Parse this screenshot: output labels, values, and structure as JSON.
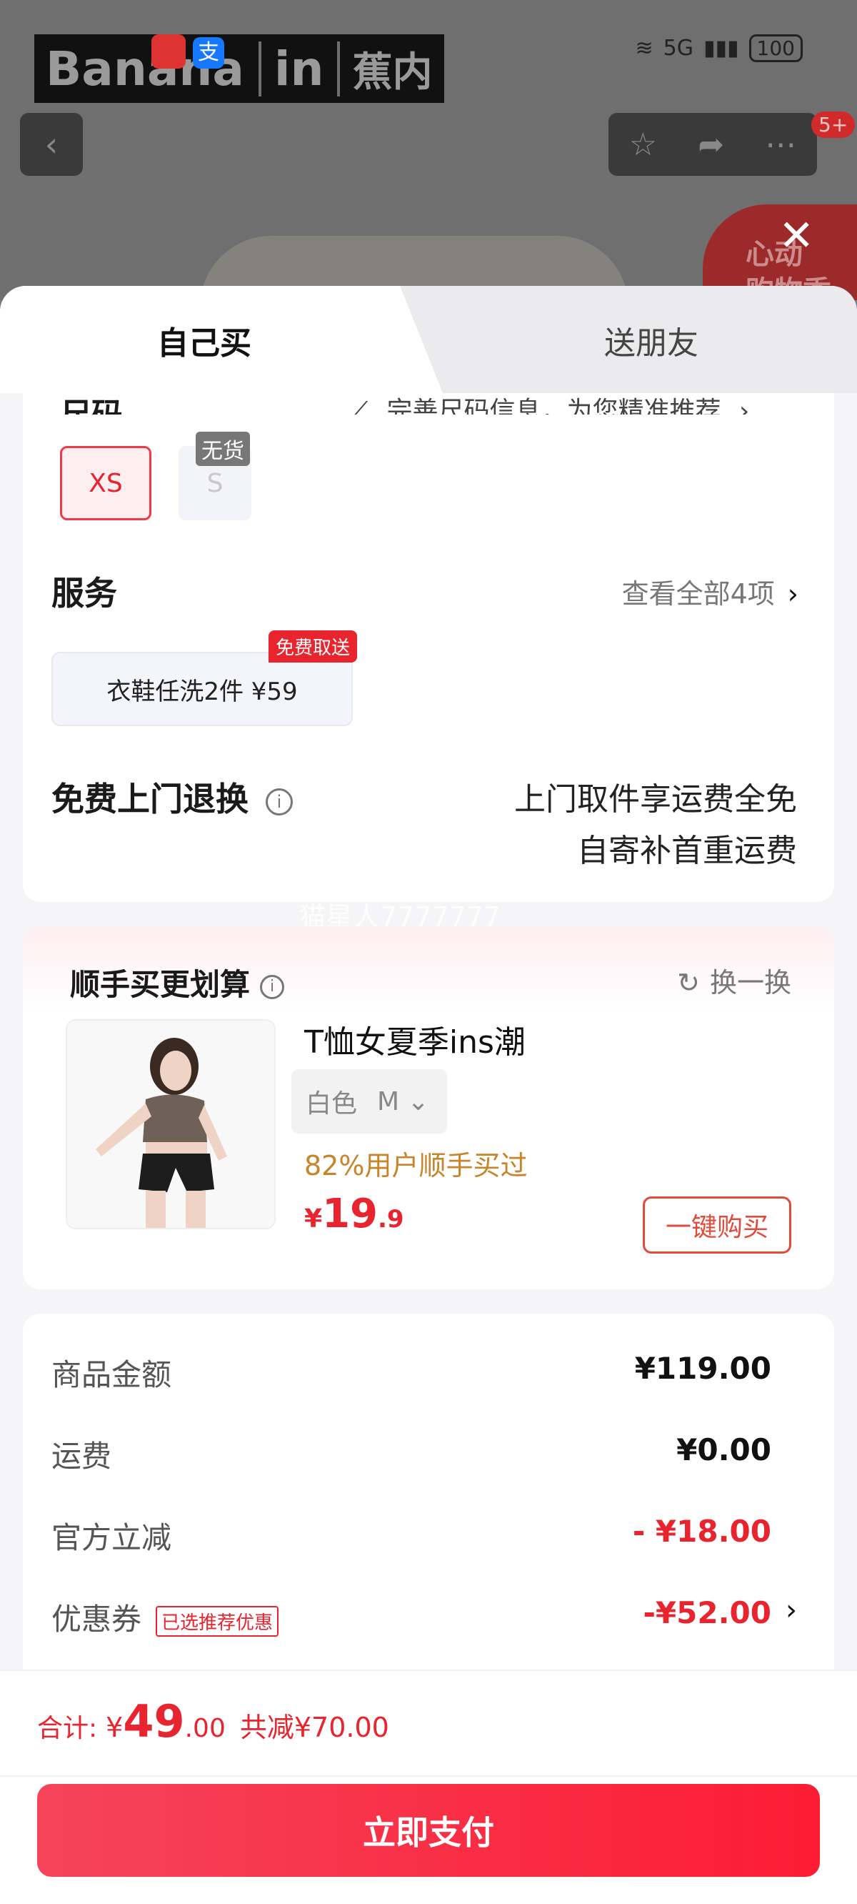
{
  "status_bar": {
    "brand_1": "Banana",
    "brand_2": "in",
    "brand_3": "蕉内",
    "signal": "5G",
    "battery": "100"
  },
  "nav": {
    "badge": "5+",
    "promo_text": "心动\n购物季"
  },
  "tabs": {
    "self_buy": "自己买",
    "gift_friend": "送朋友"
  },
  "size": {
    "title": "尺码",
    "hint": "完善尺码信息，为您精准推荐",
    "options": [
      {
        "label": "XS",
        "selected": true
      },
      {
        "label": "S",
        "selected": false,
        "tag": "无货"
      }
    ]
  },
  "service": {
    "title": "服务",
    "view_all": "查看全部4项",
    "item_label": "衣鞋任洗2件  ¥59",
    "item_tag": "免费取送"
  },
  "return": {
    "title": "免费上门退换",
    "line1": "上门取件享运费全免",
    "line2": "自寄补首重运费"
  },
  "watermark": "猫星人7777777",
  "upsell": {
    "title": "顺手买更划算",
    "swap": "换一换",
    "product_name": "T恤女夏季ins潮",
    "variant_color": "白色",
    "variant_size": "M",
    "buyers": "82%用户顺手买过",
    "price_symbol": "¥",
    "price_int": "19",
    "price_dec": ".9",
    "buy_button": "一键购买"
  },
  "summary": {
    "goods_label": "商品金额",
    "goods_value": "¥119.00",
    "shipping_label": "运费",
    "shipping_value": "¥0.00",
    "discount_label": "官方立减",
    "discount_value": "- ¥18.00",
    "coupon_label": "优惠券",
    "coupon_tag": "已选推荐优惠",
    "coupon_value": "-¥52.00"
  },
  "footer": {
    "total_label": "合计:",
    "total_symbol": "¥",
    "total_int": "49",
    "total_dec": ".00",
    "saved": "共减¥70.00",
    "pay_button": "立即支付"
  },
  "colors": {
    "accent": "#e8242f",
    "pay_start": "#f5445a",
    "pay_end": "#fc1c34",
    "buyers_orange": "#c78428"
  }
}
